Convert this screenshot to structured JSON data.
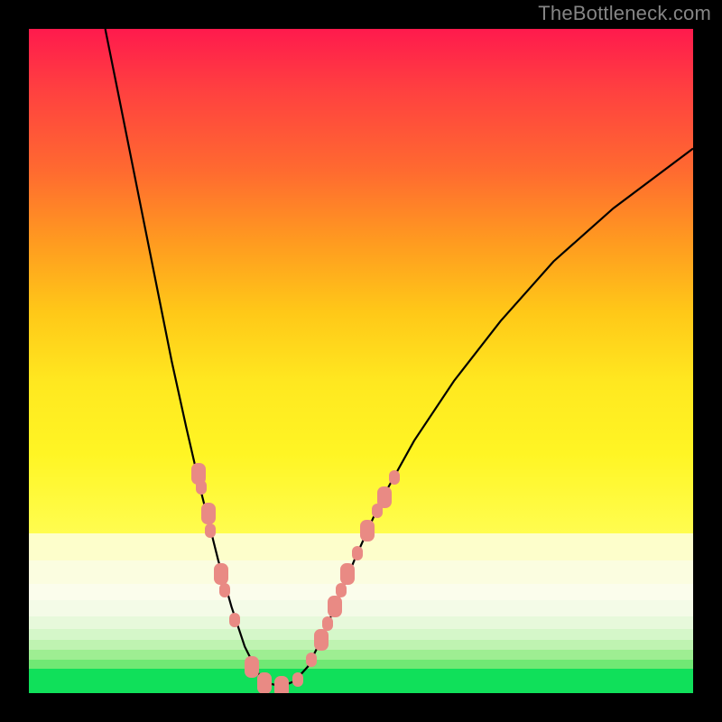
{
  "watermark": "TheBottleneck.com",
  "colors": {
    "frame": "#000000",
    "watermark": "#858585",
    "curve": "#000000",
    "marker": "#e98a84",
    "grad_top": "#ff1a4d",
    "grad_bottom": "#fffd50",
    "green": "#10e05a"
  },
  "chart_data": {
    "type": "line",
    "title": "",
    "xlabel": "",
    "ylabel": "",
    "xlim": [
      0,
      100
    ],
    "ylim": [
      0,
      100
    ],
    "notes": "V-shaped bottleneck curve over a vertical red-to-yellow gradient with pale-yellow and green horizontal bands near the bottom. Pink rounded markers cluster along the two curve arms near the trough.",
    "bands": [
      {
        "y_top": 76,
        "y_bottom": 80,
        "color": "#fdfecb"
      },
      {
        "y_top": 80,
        "y_bottom": 83.5,
        "color": "#fbfde0"
      },
      {
        "y_top": 83.5,
        "y_bottom": 86,
        "color": "#fbfdec"
      },
      {
        "y_top": 86,
        "y_bottom": 88.5,
        "color": "#f4fbe7"
      },
      {
        "y_top": 88.5,
        "y_bottom": 90.3,
        "color": "#e7f9db"
      },
      {
        "y_top": 90.3,
        "y_bottom": 92,
        "color": "#d5f7c9"
      },
      {
        "y_top": 92,
        "y_bottom": 93.5,
        "color": "#bff3b1"
      },
      {
        "y_top": 93.5,
        "y_bottom": 95,
        "color": "#9eee92"
      },
      {
        "y_top": 95,
        "y_bottom": 96.3,
        "color": "#70e874"
      },
      {
        "y_top": 96.3,
        "y_bottom": 100,
        "color": "#10e05a"
      }
    ],
    "curve": [
      {
        "x": 11.5,
        "y": 0
      },
      {
        "x": 13.5,
        "y": 10
      },
      {
        "x": 15.5,
        "y": 20
      },
      {
        "x": 17.5,
        "y": 30
      },
      {
        "x": 19.5,
        "y": 40
      },
      {
        "x": 21.5,
        "y": 50
      },
      {
        "x": 23.7,
        "y": 60
      },
      {
        "x": 26.0,
        "y": 70
      },
      {
        "x": 28.5,
        "y": 80
      },
      {
        "x": 30.5,
        "y": 87
      },
      {
        "x": 32.5,
        "y": 93
      },
      {
        "x": 34.5,
        "y": 97
      },
      {
        "x": 36.0,
        "y": 98.5
      },
      {
        "x": 38.0,
        "y": 99
      },
      {
        "x": 40.0,
        "y": 98.2
      },
      {
        "x": 42.0,
        "y": 96
      },
      {
        "x": 44.0,
        "y": 92
      },
      {
        "x": 46.5,
        "y": 86
      },
      {
        "x": 49.0,
        "y": 80
      },
      {
        "x": 53.0,
        "y": 71
      },
      {
        "x": 58.0,
        "y": 62
      },
      {
        "x": 64.0,
        "y": 53
      },
      {
        "x": 71.0,
        "y": 44
      },
      {
        "x": 79.0,
        "y": 35
      },
      {
        "x": 88.0,
        "y": 27
      },
      {
        "x": 100.0,
        "y": 18
      }
    ],
    "markers": [
      {
        "x": 25.5,
        "y": 67,
        "size": "lg"
      },
      {
        "x": 26.0,
        "y": 69,
        "size": "sm"
      },
      {
        "x": 27.0,
        "y": 73,
        "size": "lg"
      },
      {
        "x": 27.3,
        "y": 75.5,
        "size": "sm"
      },
      {
        "x": 29.0,
        "y": 82,
        "size": "lg"
      },
      {
        "x": 29.5,
        "y": 84.5,
        "size": "sm"
      },
      {
        "x": 31.0,
        "y": 89,
        "size": "sm"
      },
      {
        "x": 33.5,
        "y": 96,
        "size": "lg"
      },
      {
        "x": 35.5,
        "y": 98.5,
        "size": "lg"
      },
      {
        "x": 38.0,
        "y": 99,
        "size": "lg"
      },
      {
        "x": 40.5,
        "y": 98,
        "size": "sm"
      },
      {
        "x": 42.5,
        "y": 95,
        "size": "sm"
      },
      {
        "x": 44.0,
        "y": 92,
        "size": "lg"
      },
      {
        "x": 45.0,
        "y": 89.5,
        "size": "sm"
      },
      {
        "x": 46.0,
        "y": 87,
        "size": "lg"
      },
      {
        "x": 47.0,
        "y": 84.5,
        "size": "sm"
      },
      {
        "x": 48.0,
        "y": 82,
        "size": "lg"
      },
      {
        "x": 49.5,
        "y": 79,
        "size": "sm"
      },
      {
        "x": 51.0,
        "y": 75.5,
        "size": "lg"
      },
      {
        "x": 52.5,
        "y": 72.5,
        "size": "sm"
      },
      {
        "x": 53.5,
        "y": 70.5,
        "size": "lg"
      },
      {
        "x": 55.0,
        "y": 67.5,
        "size": "sm"
      }
    ]
  }
}
